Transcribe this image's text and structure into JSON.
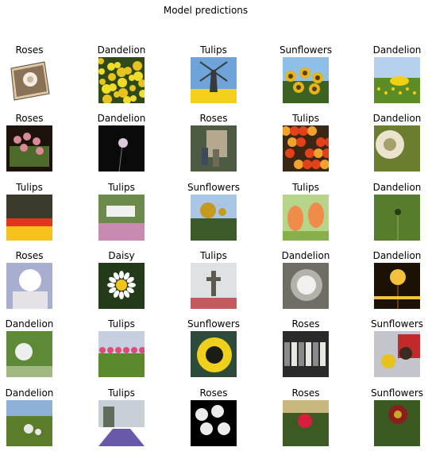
{
  "figure": {
    "title": "Model predictions",
    "images": [
      {
        "label": "Roses",
        "scene": "rose-tilted",
        "colors": [
          "#ffffff",
          "#8a7256",
          "#ddc9a8"
        ]
      },
      {
        "label": "Dandelion",
        "scene": "yellow-field",
        "colors": [
          "#2f4a16",
          "#f2dc2a",
          "#e7c31b"
        ]
      },
      {
        "label": "Tulips",
        "scene": "windmill",
        "colors": [
          "#6fa4db",
          "#3a3a3a",
          "#f4cf1b"
        ]
      },
      {
        "label": "Sunflowers",
        "scene": "sunflower-field",
        "colors": [
          "#8ebfe8",
          "#e5b41b",
          "#3b6220"
        ]
      },
      {
        "label": "Dandelion",
        "scene": "dandelion-meadow",
        "colors": [
          "#b4d1ee",
          "#5c8d25",
          "#f2cf17"
        ]
      },
      {
        "label": "Roses",
        "scene": "rose-bouquet",
        "colors": [
          "#1d120c",
          "#d98a97",
          "#4f6b2b"
        ]
      },
      {
        "label": "Dandelion",
        "scene": "seedhead-dark",
        "colors": [
          "#0a0a0a",
          "#d9c9da",
          "#7b7383"
        ]
      },
      {
        "label": "Roses",
        "scene": "garden-people",
        "colors": [
          "#4d5a44",
          "#b4a88f",
          "#3c4a5e"
        ]
      },
      {
        "label": "Tulips",
        "scene": "red-tulips",
        "colors": [
          "#3a2814",
          "#e4401a",
          "#f1a22a"
        ]
      },
      {
        "label": "Dandelion",
        "scene": "seedhead-green",
        "colors": [
          "#6b7d2e",
          "#ece3cf",
          "#a6a06a"
        ]
      },
      {
        "label": "Tulips",
        "scene": "tulip-rows",
        "colors": [
          "#3b3a2c",
          "#e0361c",
          "#f5c21b"
        ]
      },
      {
        "label": "Tulips",
        "scene": "bench-garden",
        "colors": [
          "#6c8a4b",
          "#f0f0f0",
          "#c88ab0"
        ]
      },
      {
        "label": "Sunflowers",
        "scene": "sunflower-sky",
        "colors": [
          "#a9c6e4",
          "#c49a20",
          "#3d5a2a"
        ]
      },
      {
        "label": "Tulips",
        "scene": "orange-tulips",
        "colors": [
          "#b7d58a",
          "#f08c4a",
          "#86b04a"
        ]
      },
      {
        "label": "Dandelion",
        "scene": "bud-blur",
        "colors": [
          "#557d2c",
          "#2b3a18",
          "#8fb05a"
        ]
      },
      {
        "label": "Roses",
        "scene": "white-rose",
        "colors": [
          "#a7aed0",
          "#ffffff",
          "#e4e2e6"
        ]
      },
      {
        "label": "Daisy",
        "scene": "daisy",
        "colors": [
          "#233b19",
          "#ffffff",
          "#f2c417"
        ]
      },
      {
        "label": "Tulips",
        "scene": "memorial",
        "colors": [
          "#dfe2e4",
          "#5e5a50",
          "#c25a5e"
        ]
      },
      {
        "label": "Dandelion",
        "scene": "seedhead-grey",
        "colors": [
          "#6f6d66",
          "#f2f0ee",
          "#b5b2ab"
        ]
      },
      {
        "label": "Dandelion",
        "scene": "sunset-seedhead",
        "colors": [
          "#1b1105",
          "#f3c13a",
          "#6a3d0e"
        ]
      },
      {
        "label": "Dandelion",
        "scene": "seedhead-meadow",
        "colors": [
          "#5e8a38",
          "#eeeeee",
          "#a0b880"
        ]
      },
      {
        "label": "Tulips",
        "scene": "tulip-field-sky",
        "colors": [
          "#c5cfe0",
          "#e04c7a",
          "#5a8a2c"
        ]
      },
      {
        "label": "Sunflowers",
        "scene": "sunflower-closeup",
        "colors": [
          "#2d4a3a",
          "#efd01c",
          "#1c1c16"
        ]
      },
      {
        "label": "Roses",
        "scene": "parade",
        "colors": [
          "#2a2a2a",
          "#e8e6e0",
          "#8a8a8a"
        ]
      },
      {
        "label": "Sunflowers",
        "scene": "people-sunflower",
        "colors": [
          "#c4c4cc",
          "#c02a2a",
          "#e5c21c"
        ]
      },
      {
        "label": "Dandelion",
        "scene": "dandelion-grass",
        "colors": [
          "#8fb0d6",
          "#5b7d2a",
          "#e8e8e8"
        ]
      },
      {
        "label": "Tulips",
        "scene": "lavender-rows",
        "colors": [
          "#c8ced6",
          "#6a58a8",
          "#5f6d5a"
        ]
      },
      {
        "label": "Roses",
        "scene": "white-roses-black",
        "colors": [
          "#000000",
          "#ececec",
          "#a0a0a0"
        ]
      },
      {
        "label": "Roses",
        "scene": "red-rose-garden",
        "colors": [
          "#3c5a24",
          "#d81e3c",
          "#c8b87e"
        ]
      },
      {
        "label": "Sunflowers",
        "scene": "red-sunflower",
        "colors": [
          "#3a5a22",
          "#8a1e1a",
          "#caa52a"
        ]
      }
    ]
  }
}
